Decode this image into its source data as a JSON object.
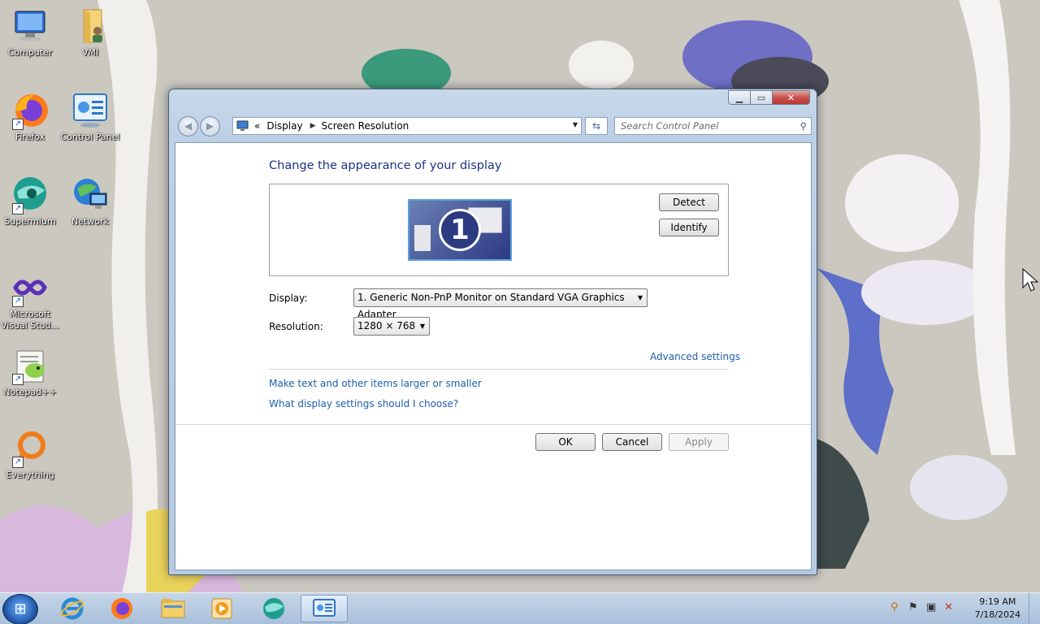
{
  "desktop": {
    "icons": [
      {
        "label": "Computer",
        "icon": "computer-icon"
      },
      {
        "label": "VMI",
        "icon": "user-folder-icon"
      },
      {
        "label": "Firefox",
        "icon": "firefox-icon"
      },
      {
        "label": "Control Panel",
        "icon": "control-panel-icon"
      },
      {
        "label": "Supermium",
        "icon": "supermium-icon"
      },
      {
        "label": "Network",
        "icon": "network-icon"
      },
      {
        "label": "Microsoft Visual Stud...",
        "icon": "visual-studio-icon"
      },
      {
        "label": "Notepad++",
        "icon": "notepadpp-icon"
      },
      {
        "label": "Everything",
        "icon": "everything-icon"
      }
    ]
  },
  "window": {
    "breadcrumb": {
      "chevrons": "«",
      "items": [
        "Display",
        "Screen Resolution"
      ]
    },
    "search_placeholder": "Search Control Panel",
    "heading": "Change the appearance of your display",
    "monitor_number": "1",
    "detect_label": "Detect",
    "identify_label": "Identify",
    "display_label": "Display:",
    "display_value": "1. Generic Non-PnP Monitor on Standard VGA Graphics Adapter",
    "resolution_label": "Resolution:",
    "resolution_value": "1280 × 768",
    "advanced_link": "Advanced settings",
    "text_size_link": "Make text and other items larger or smaller",
    "help_link": "What display settings should I choose?",
    "ok_label": "OK",
    "cancel_label": "Cancel",
    "apply_label": "Apply"
  },
  "taskbar": {
    "items": [
      "start-orb",
      "internet-explorer-icon",
      "firefox-icon",
      "file-explorer-icon",
      "media-player-icon",
      "supermium-icon",
      "control-panel-icon"
    ],
    "time": "9:19 AM",
    "date": "7/18/2024"
  },
  "colors": {
    "heading": "#1e3287",
    "link": "#1c5fab",
    "taskbar": "#b4c8df"
  }
}
